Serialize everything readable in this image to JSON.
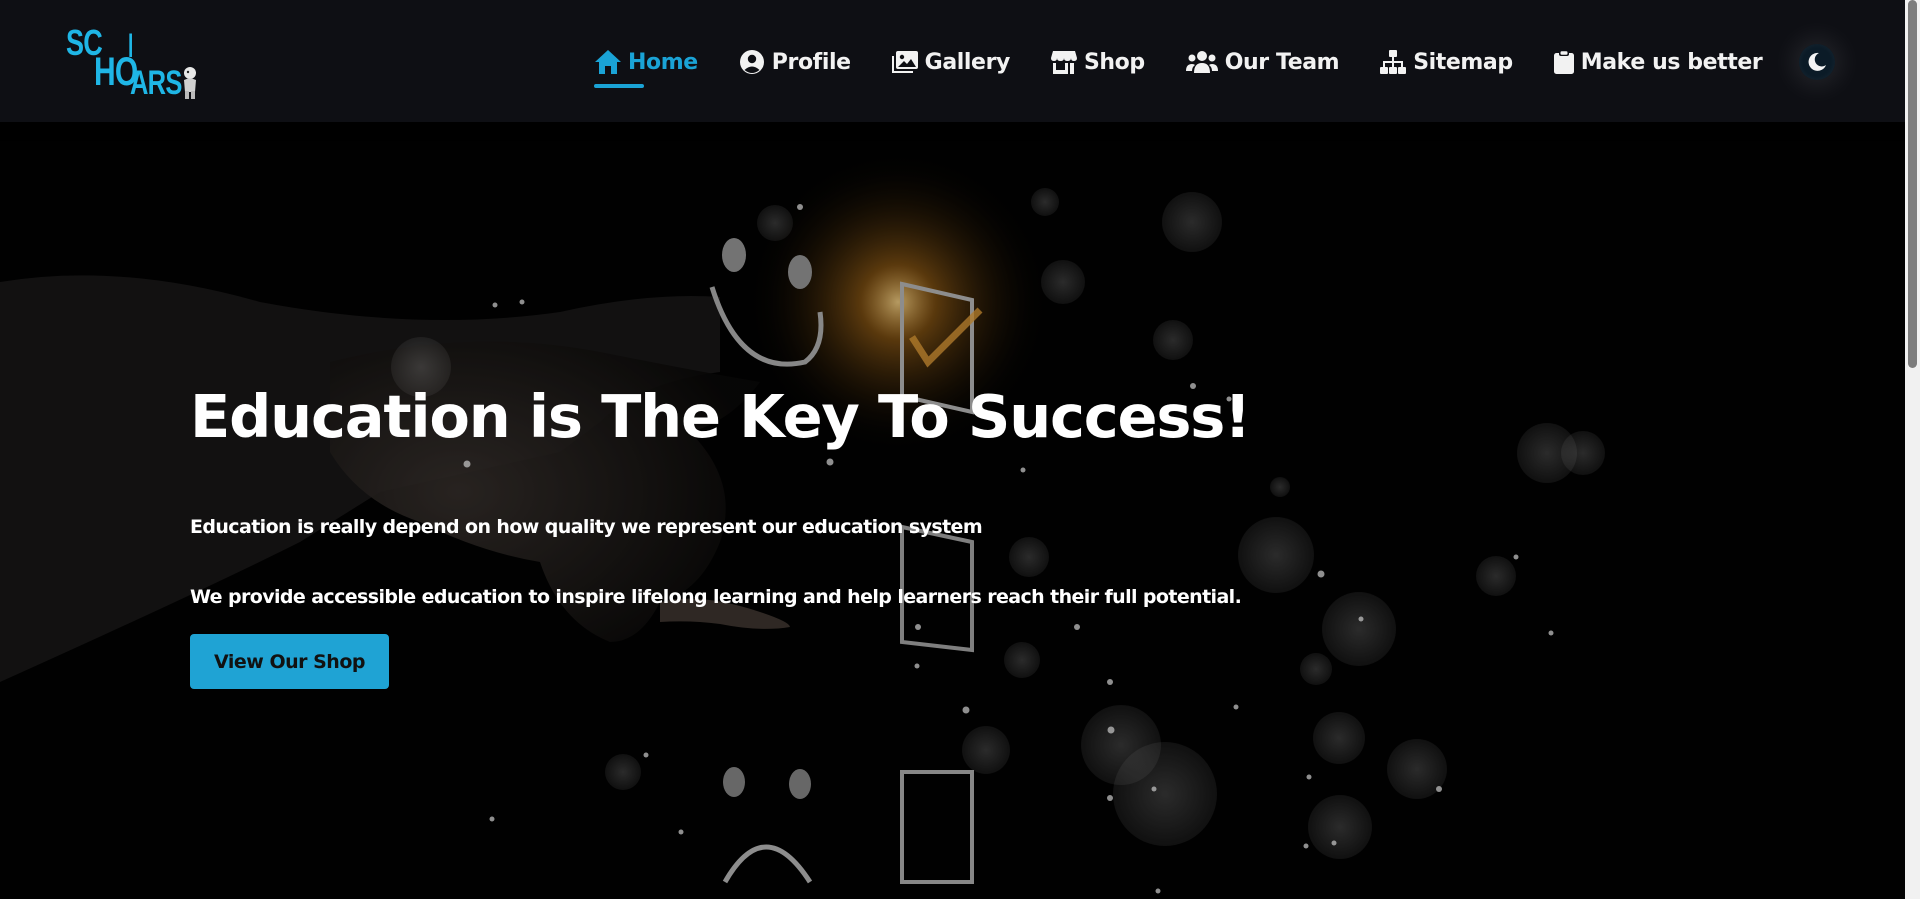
{
  "brand": {
    "logo_text": "SCHOLARS"
  },
  "nav": {
    "items": [
      {
        "label": "Home",
        "icon": "home-icon",
        "active": true
      },
      {
        "label": "Profile",
        "icon": "user-circle-icon",
        "active": false
      },
      {
        "label": "Gallery",
        "icon": "images-icon",
        "active": false
      },
      {
        "label": "Shop",
        "icon": "store-icon",
        "active": false
      },
      {
        "label": "Our Team",
        "icon": "users-icon",
        "active": false
      },
      {
        "label": "Sitemap",
        "icon": "sitemap-icon",
        "active": false
      },
      {
        "label": "Make us better",
        "icon": "clipboard-icon",
        "active": false
      }
    ],
    "theme_toggle_icon": "moon-icon"
  },
  "hero": {
    "title": "Education is The Key To Success!",
    "subtitle_1": "Education is really depend on how quality we represent our education system",
    "subtitle_2": "We provide accessible education to inspire lifelong learning and help learners reach their full potential.",
    "cta_label": "View Our Shop"
  },
  "colors": {
    "accent": "#1fa3d4",
    "header_bg": "#0e0f14",
    "logo": "#1fb6e6"
  }
}
